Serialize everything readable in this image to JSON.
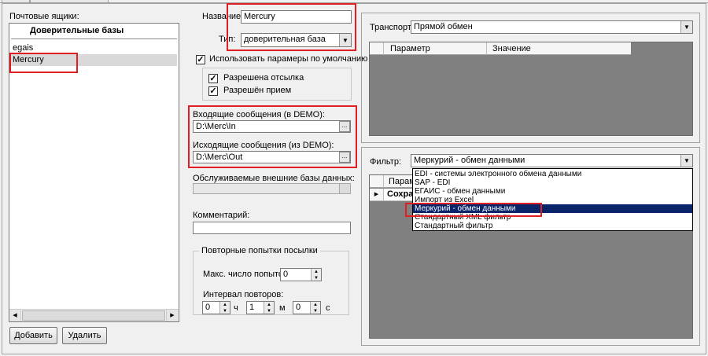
{
  "mailboxes": {
    "label": "Почтовые ящики:",
    "group_header": "Доверительные базы",
    "items": [
      "egais",
      "Mercury"
    ],
    "selected": "Mercury"
  },
  "buttons": {
    "add": "Добавить",
    "delete": "Удалить"
  },
  "form": {
    "name_label": "Название:",
    "name_value": "Mercury",
    "type_label": "Тип:",
    "type_value": "доверительная база",
    "use_defaults_label": "Использовать парамеры по умолчанию",
    "allow_send_label": "Разрешена отсылка",
    "allow_receive_label": "Разрешён прием",
    "incoming_label": "Входящие сообщения (в DEMO):",
    "incoming_value": "D:\\Merc\\In",
    "outgoing_label": "Исходящие сообщения (из DEMO):",
    "outgoing_value": "D:\\Merc\\Out",
    "browse_label": "...",
    "external_db_label": "Обслуживаемые внешние базы данных:",
    "comment_label": "Комментарий:",
    "comment_value": "",
    "retry_group_label": "Повторные попытки посылки",
    "max_attempts_label": "Макс. число попыток:",
    "max_attempts_value": "0",
    "interval_label": "Интервал повторов:",
    "interval_h_value": "0",
    "interval_h_unit": "ч",
    "interval_m_value": "1",
    "interval_m_unit": "м",
    "interval_s_value": "0",
    "interval_s_unit": "с"
  },
  "transport": {
    "label": "Транспорт:",
    "value": "Прямой обмен",
    "columns": [
      "Параметр",
      "Значение"
    ]
  },
  "filter": {
    "label": "Фильтр:",
    "value": "Меркурий - обмен данными",
    "grid_header_partial": "Парам",
    "grid_row_partial": "Сохра",
    "options": [
      "EDI - системы электронного обмена данными",
      "SAP - EDI",
      "ЕГАИС - обмен данными",
      "Импорт из Excel",
      "Меркурий - обмен данными",
      "Стандартный XML фильтр",
      "Стандартный фильтр"
    ],
    "highlighted": "Меркурий - обмен данными"
  }
}
